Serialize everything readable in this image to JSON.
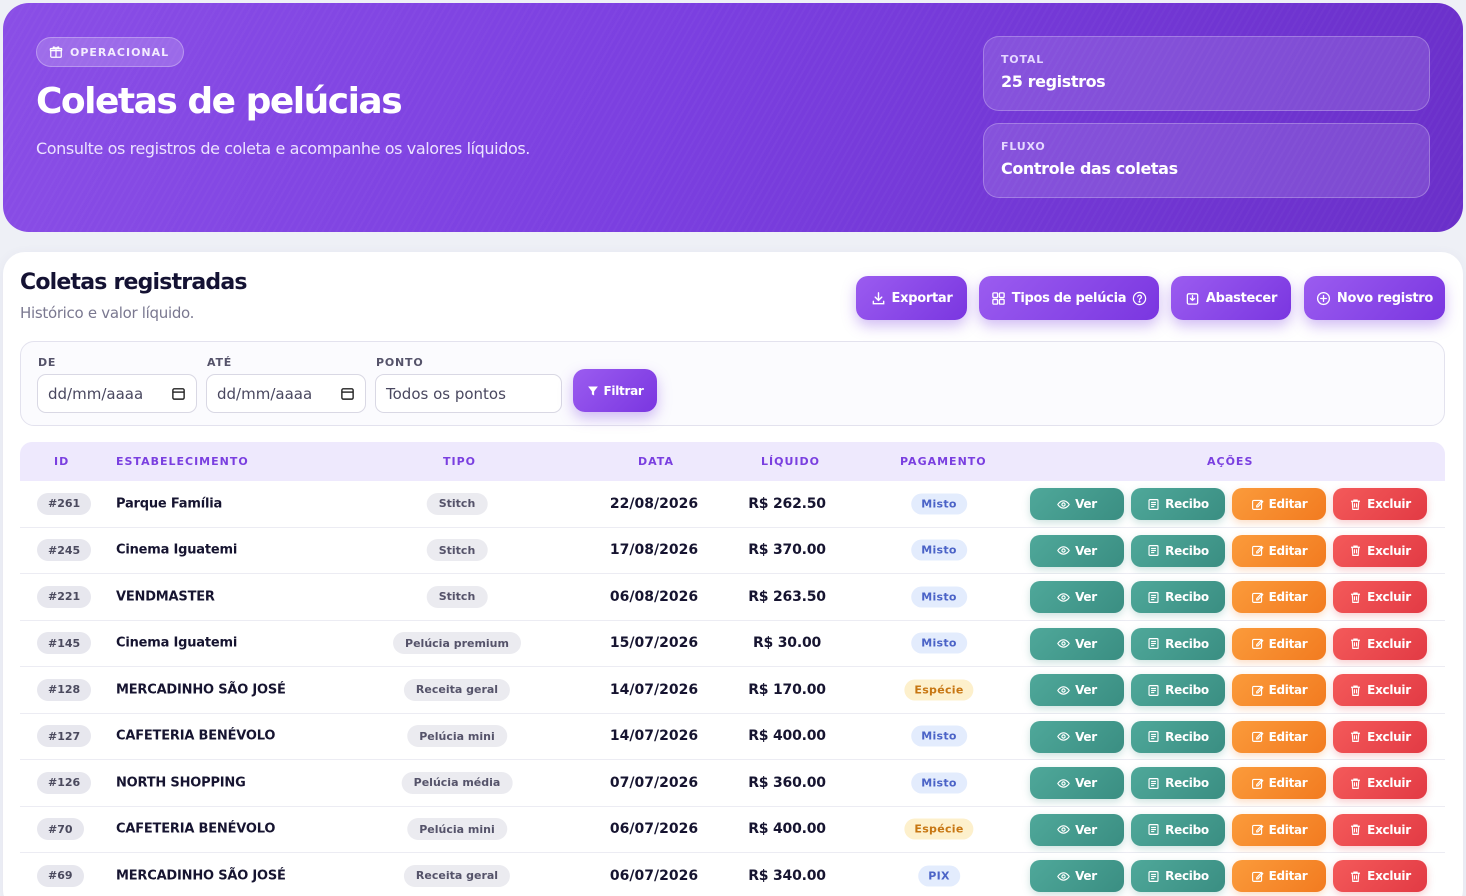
{
  "hero": {
    "chip": "OPERACIONAL",
    "title": "Coletas de pelúcias",
    "subtitle": "Consulte os registros de coleta e acompanhe os valores líquidos.",
    "stats": [
      {
        "label": "TOTAL",
        "value": "25 registros"
      },
      {
        "label": "FLUXO",
        "value": "Controle das coletas"
      }
    ]
  },
  "panel": {
    "title": "Coletas registradas",
    "subtitle": "Histórico e valor líquido.",
    "buttons": {
      "export": "Exportar",
      "types": "Tipos de pelúcia",
      "supply": "Abastecer",
      "new": "Novo registro"
    }
  },
  "filters": {
    "from_label": "DE",
    "from_placeholder": "dd/mm/aaaa",
    "to_label": "ATÉ",
    "to_placeholder": "dd/mm/aaaa",
    "point_label": "PONTO",
    "point_value": "Todos os pontos",
    "filter_button": "Filtrar"
  },
  "table": {
    "headers": {
      "id": "ID",
      "establishment": "ESTABELECIMENTO",
      "type": "TIPO",
      "date": "DATA",
      "net": "LÍQUIDO",
      "payment": "PAGAMENTO",
      "actions": "AÇÕES"
    },
    "action_labels": {
      "view": "Ver",
      "receipt": "Recibo",
      "edit": "Editar",
      "delete": "Excluir"
    },
    "rows": [
      {
        "id": "#261",
        "establishment": "Parque Família",
        "type": "Stitch",
        "date": "22/08/2026",
        "net": "R$ 262.50",
        "payment": "Misto",
        "payment_kind": "misto"
      },
      {
        "id": "#245",
        "establishment": "Cinema Iguatemi",
        "type": "Stitch",
        "date": "17/08/2026",
        "net": "R$ 370.00",
        "payment": "Misto",
        "payment_kind": "misto"
      },
      {
        "id": "#221",
        "establishment": "VENDMASTER",
        "type": "Stitch",
        "date": "06/08/2026",
        "net": "R$ 263.50",
        "payment": "Misto",
        "payment_kind": "misto"
      },
      {
        "id": "#145",
        "establishment": "Cinema Iguatemi",
        "type": "Pelúcia premium",
        "date": "15/07/2026",
        "net": "R$ 30.00",
        "payment": "Misto",
        "payment_kind": "misto"
      },
      {
        "id": "#128",
        "establishment": "MERCADINHO SÃO JOSÉ",
        "type": "Receita geral",
        "date": "14/07/2026",
        "net": "R$ 170.00",
        "payment": "Espécie",
        "payment_kind": "especie"
      },
      {
        "id": "#127",
        "establishment": "CAFETERIA BENÉVOLO",
        "type": "Pelúcia mini",
        "date": "14/07/2026",
        "net": "R$ 400.00",
        "payment": "Misto",
        "payment_kind": "misto"
      },
      {
        "id": "#126",
        "establishment": "NORTH SHOPPING",
        "type": "Pelúcia média",
        "date": "07/07/2026",
        "net": "R$ 360.00",
        "payment": "Misto",
        "payment_kind": "misto"
      },
      {
        "id": "#70",
        "establishment": "CAFETERIA BENÉVOLO",
        "type": "Pelúcia mini",
        "date": "06/07/2026",
        "net": "R$ 400.00",
        "payment": "Espécie",
        "payment_kind": "especie"
      },
      {
        "id": "#69",
        "establishment": "MERCADINHO SÃO JOSÉ",
        "type": "Receita geral",
        "date": "06/07/2026",
        "net": "R$ 340.00",
        "payment": "PIX",
        "payment_kind": "pix"
      }
    ]
  }
}
